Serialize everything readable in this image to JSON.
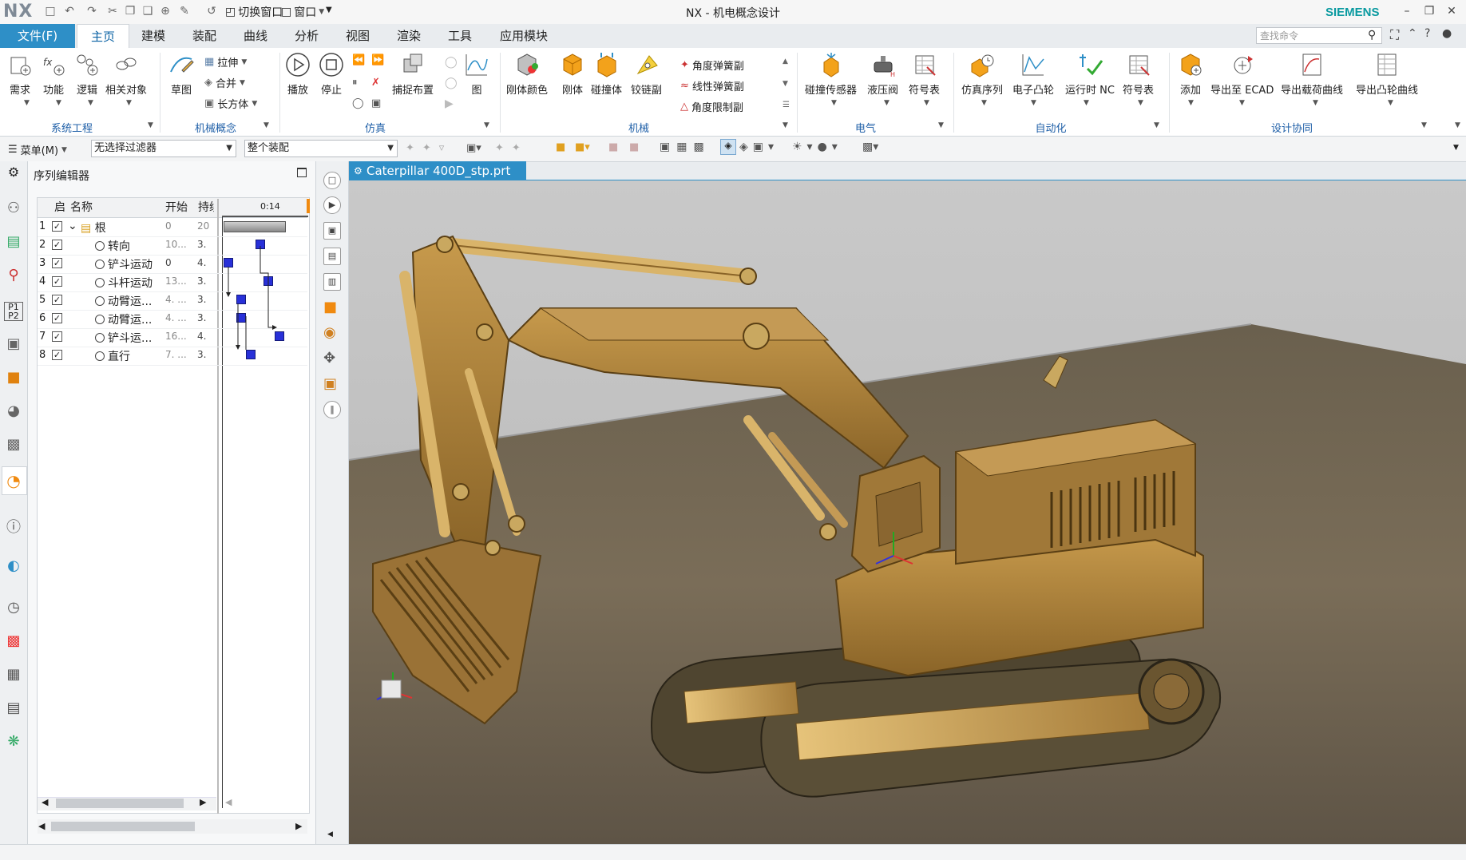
{
  "window": {
    "app_logo": "NX",
    "title": "NX - 机电概念设计",
    "brand": "SIEMENS"
  },
  "quick_access": {
    "switch_window": "切换窗口",
    "window_menu": "窗口"
  },
  "menu": {
    "file": "文件(F)",
    "tabs": [
      "主页",
      "建模",
      "装配",
      "曲线",
      "分析",
      "视图",
      "渲染",
      "工具",
      "应用模块"
    ],
    "active_tab": "主页",
    "search_placeholder": "查找命令"
  },
  "ribbon": {
    "groups": {
      "system_eng": "系统工程",
      "mech_concept": "机械概念",
      "simulation": "仿真",
      "mechanical": "机械",
      "electrical": "电气",
      "automation": "自动化",
      "design_collab": "设计协同"
    },
    "system_eng": [
      "需求",
      "功能",
      "逻辑",
      "相关对象"
    ],
    "mech_concept": {
      "sketch": "草图",
      "extrude": "拉伸",
      "unite": "合并",
      "block": "长方体"
    },
    "simulation": {
      "play": "播放",
      "stop": "停止",
      "snap": "捕捉布置",
      "chart": "图"
    },
    "mechanical": {
      "rigid_color": "刚体颜色",
      "rigid": "刚体",
      "collision": "碰撞体",
      "hinge": "铰链副",
      "angular_spring": "角度弹簧副",
      "linear_spring": "线性弹簧副",
      "angle_limit": "角度限制副"
    },
    "electrical": {
      "collision_sensor": "碰撞传感器",
      "hydraulic_valve": "液压阀",
      "symbol_table": "符号表"
    },
    "automation": {
      "sim_sequence": "仿真序列",
      "e_cam": "电子凸轮",
      "runtime_nc": "运行时 NC",
      "symbol_table": "符号表"
    },
    "design_collab": {
      "add": "添加",
      "export_ecad": "导出至 ECAD",
      "export_load": "导出载荷曲线",
      "export_cam": "导出凸轮曲线"
    }
  },
  "filterbar": {
    "menu": "菜单(M)",
    "filter": "无选择过滤器",
    "scope": "整个装配"
  },
  "sequence_editor": {
    "title": "序列编辑器",
    "columns": {
      "enabled": "启",
      "name": "名称",
      "start": "开始",
      "duration": "持续"
    },
    "timeline_tick": "0:14",
    "rows": [
      {
        "n": "1",
        "name": "根",
        "start": "0",
        "dur": "20"
      },
      {
        "n": "2",
        "name": "转向",
        "start": "10...",
        "dur": "3."
      },
      {
        "n": "3",
        "name": "铲斗运动",
        "start": "0",
        "dur": "4."
      },
      {
        "n": "4",
        "name": "斗杆运动",
        "start": "13...",
        "dur": "3."
      },
      {
        "n": "5",
        "name": "动臂运...",
        "start": "4. ...",
        "dur": "3."
      },
      {
        "n": "6",
        "name": "动臂运...",
        "start": "4. ...",
        "dur": "3."
      },
      {
        "n": "7",
        "name": "铲斗运...",
        "start": "16...",
        "dur": "4."
      },
      {
        "n": "8",
        "name": "直行",
        "start": "7. ...",
        "dur": "3."
      }
    ]
  },
  "document_tab": {
    "label": "Caterpillar 400D_stp.prt",
    "close": "×"
  },
  "colors": {
    "accent": "#2e8fc7",
    "brand": "#0a9aa0",
    "model": "#a57c3a",
    "gantt": "#2830d8"
  }
}
